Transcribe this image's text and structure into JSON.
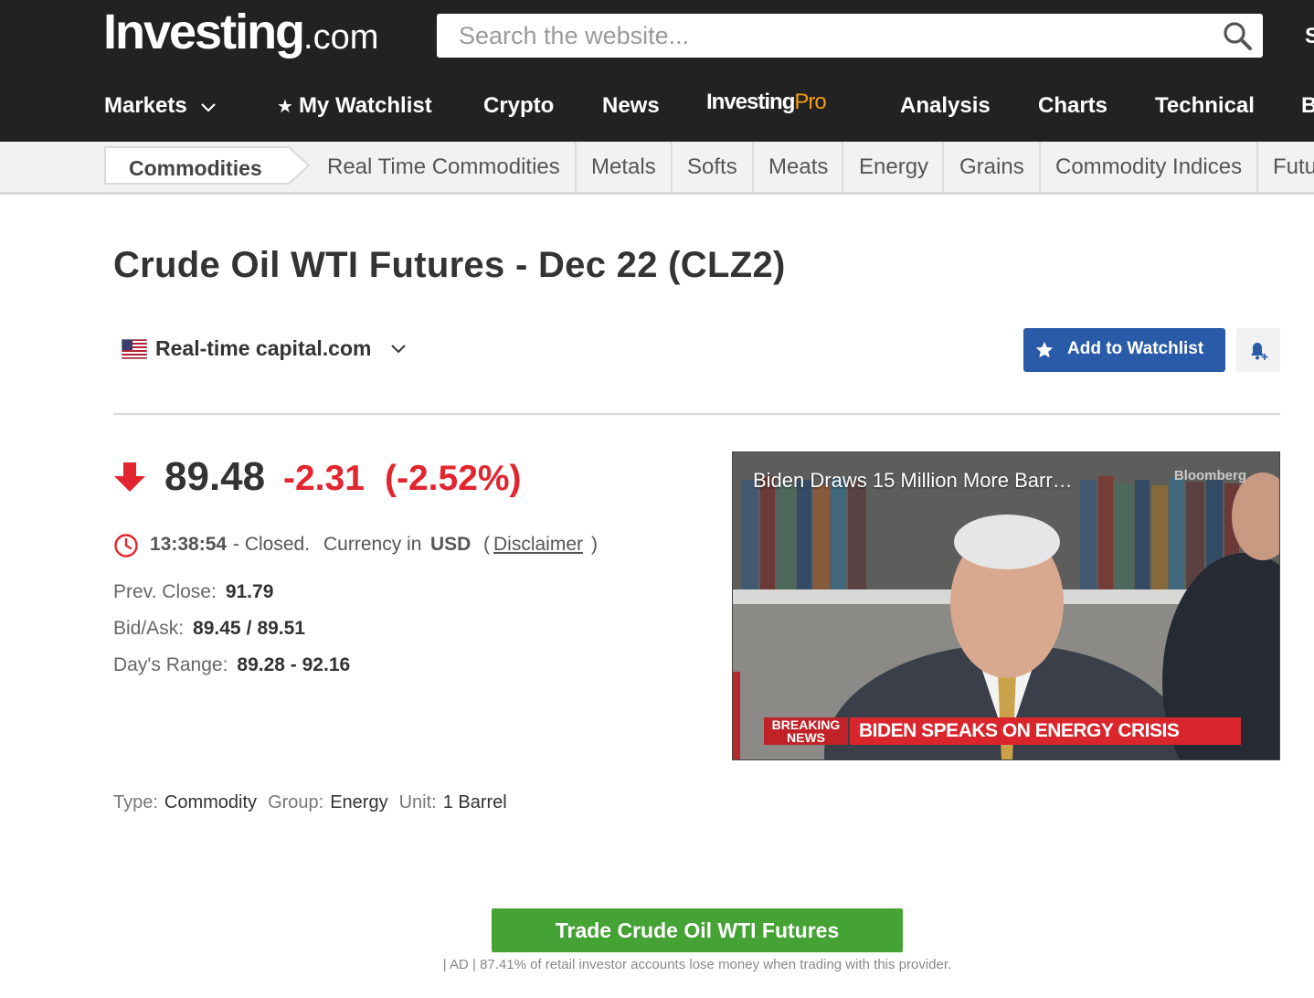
{
  "logo": {
    "main": "Investing",
    "suffix": ".com"
  },
  "search": {
    "placeholder": "Search the website..."
  },
  "header_cut_text": "S",
  "nav": {
    "markets": "Markets",
    "watchlist": "My Watchlist",
    "crypto": "Crypto",
    "news": "News",
    "pro_investing": "Investing",
    "pro_pro": "Pro",
    "analysis": "Analysis",
    "charts": "Charts",
    "technical": "Technical",
    "cut": "B"
  },
  "subnav": {
    "active": "Commodities",
    "items": [
      "Real Time Commodities",
      "Metals",
      "Softs",
      "Meats",
      "Energy",
      "Grains",
      "Commodity Indices",
      "Futu"
    ]
  },
  "instrument": {
    "title": "Crude Oil WTI Futures - Dec 22 (CLZ2)",
    "source": "Real-time capital.com",
    "add_watchlist": "Add to Watchlist"
  },
  "quote": {
    "price": "89.48",
    "change": "-2.31",
    "change_pct": "(-2.52%)",
    "time": "13:38:54",
    "status": "- Closed.",
    "currency_label": "Currency in",
    "currency": "USD",
    "paren_open": "(",
    "disclaimer": "Disclaimer",
    "paren_close": ")",
    "prev_close_label": "Prev. Close:",
    "prev_close": "91.79",
    "bid_ask_label": "Bid/Ask:",
    "bid": "89.45",
    "ask": "89.51",
    "bid_ask_sep": "/",
    "range_label": "Day's Range:",
    "range": "89.28 - 92.16"
  },
  "meta": {
    "type_label": "Type:",
    "type": "Commodity",
    "group_label": "Group:",
    "group": "Energy",
    "unit_label": "Unit:",
    "unit": "1 Barrel"
  },
  "video": {
    "title": "Biden Draws 15 Million More Barr…",
    "brand": "Bloomberg",
    "breaking": "BREAKING",
    "news": "NEWS",
    "crawl": "BIDEN SPEAKS ON ENERGY CRISIS"
  },
  "trade": {
    "button": "Trade Crude Oil WTI Futures",
    "disclaimer": "| AD | 87.41% of retail investor accounts lose money when trading with this provider."
  },
  "colors": {
    "header_bg": "#222222",
    "down_red": "#e2252e",
    "watchlist_blue": "#2a5ba8",
    "trade_green": "#45a234",
    "pro_orange": "#f39c12"
  }
}
